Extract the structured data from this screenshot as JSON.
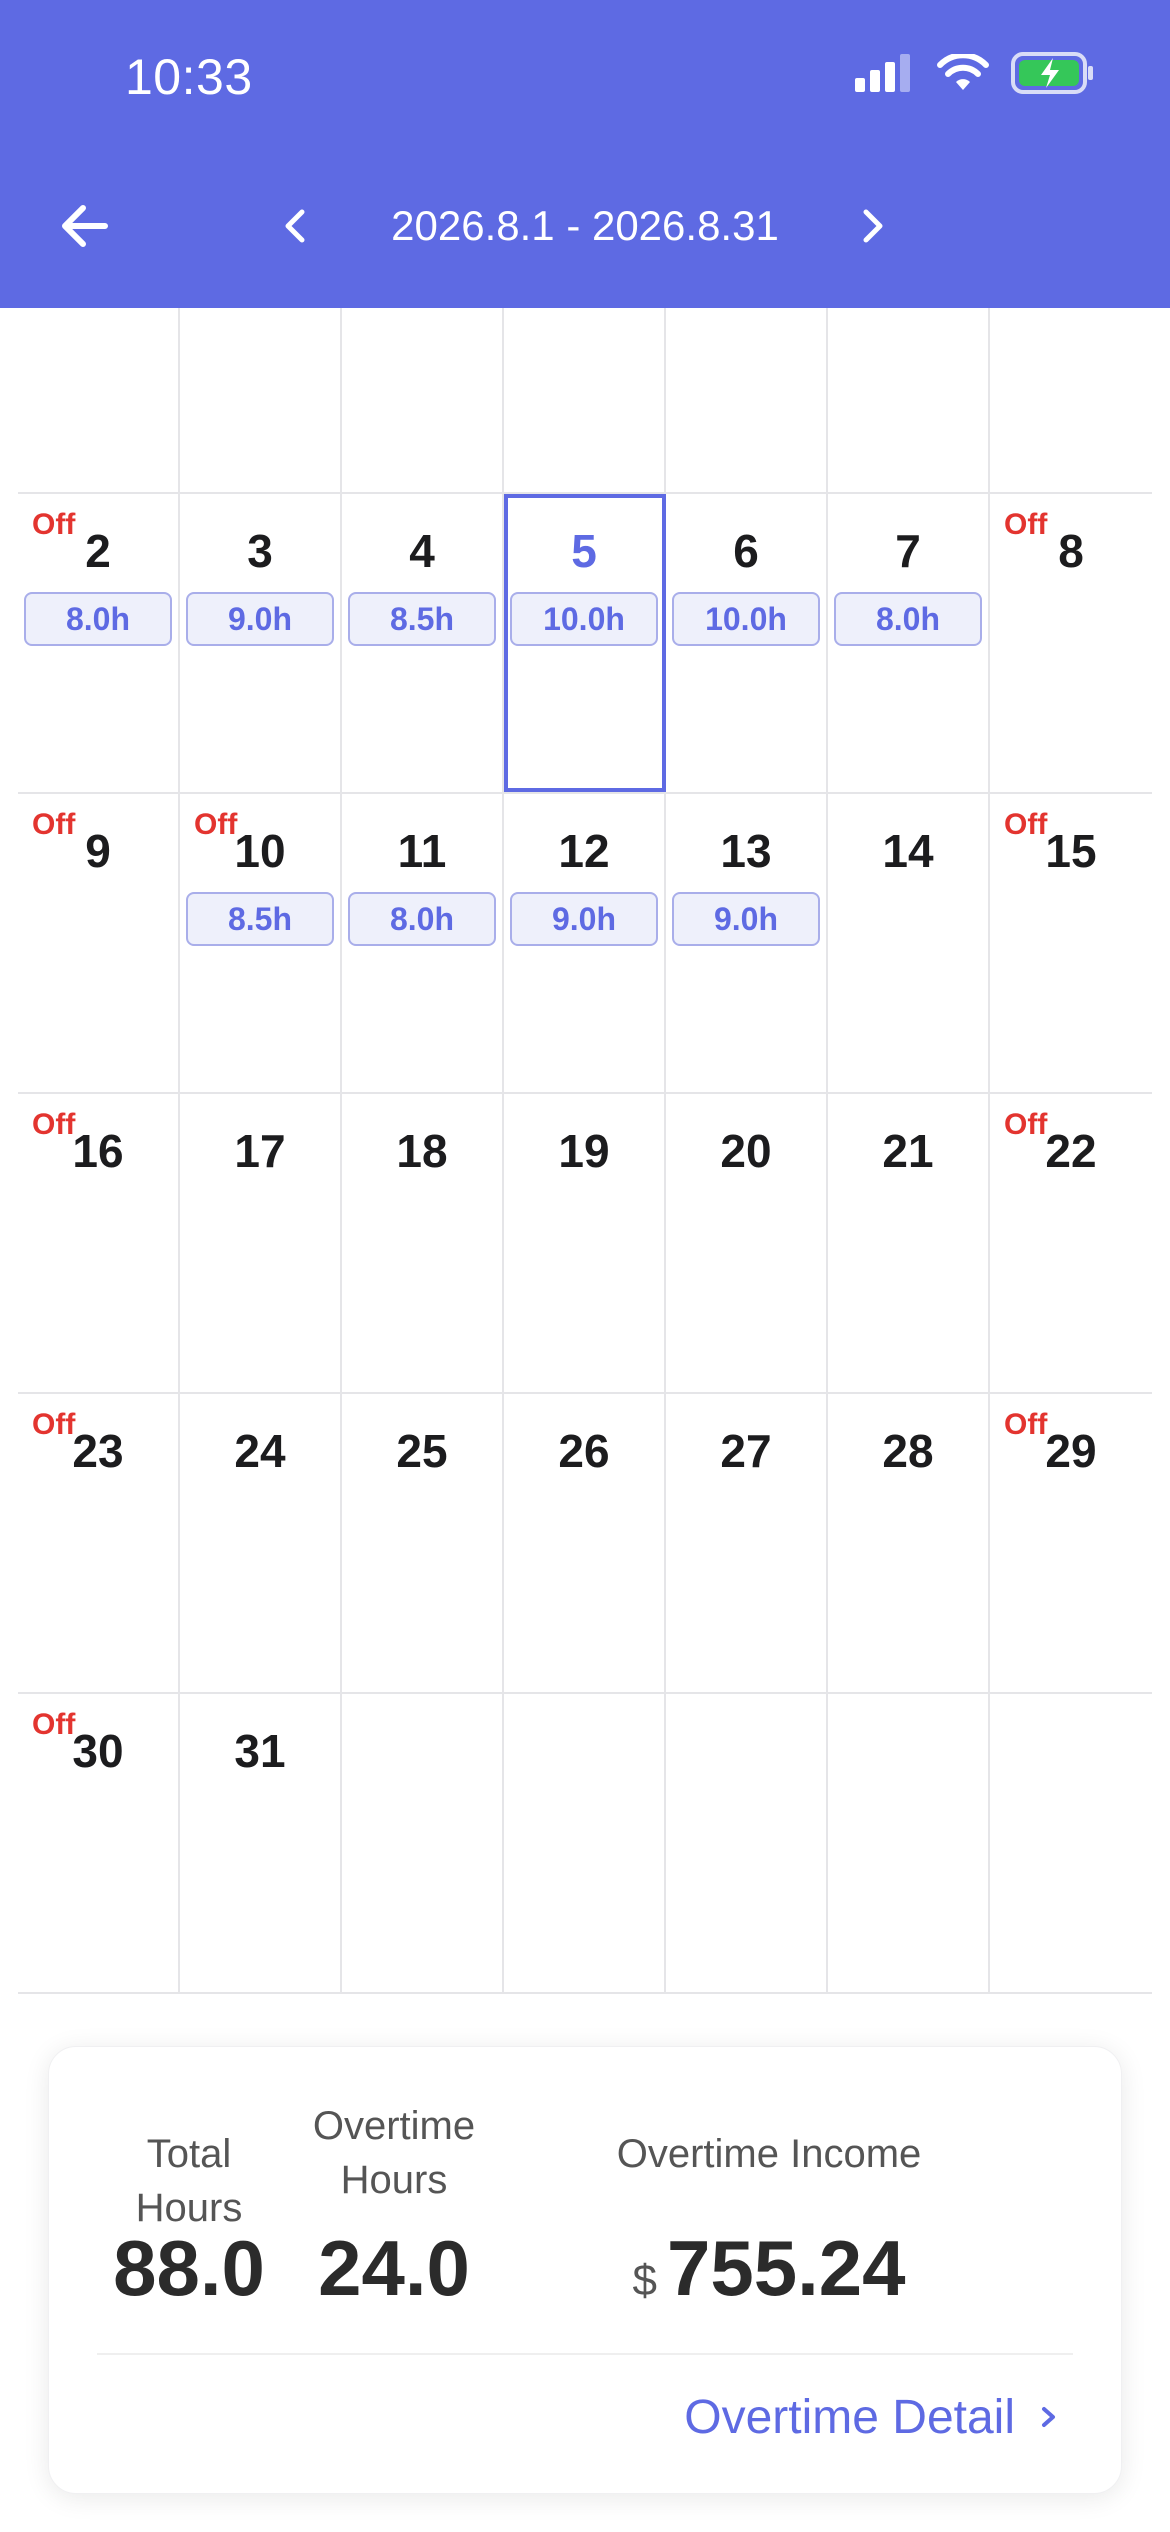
{
  "status_bar": {
    "time": "10:33"
  },
  "header": {
    "date_range": "2026.8.1 - 2026.8.31"
  },
  "calendar": {
    "off_label": "Off",
    "rows": [
      [
        {
          "d": ""
        },
        {
          "d": ""
        },
        {
          "d": ""
        },
        {
          "d": ""
        },
        {
          "d": ""
        },
        {
          "d": ""
        },
        {
          "d": ""
        }
      ],
      [
        {
          "d": "2",
          "off": true,
          "h": "8.0h"
        },
        {
          "d": "3",
          "h": "9.0h"
        },
        {
          "d": "4",
          "h": "8.5h"
        },
        {
          "d": "5",
          "h": "10.0h",
          "sel": true
        },
        {
          "d": "6",
          "h": "10.0h"
        },
        {
          "d": "7",
          "h": "8.0h"
        },
        {
          "d": "8",
          "off": true
        }
      ],
      [
        {
          "d": "9",
          "off": true
        },
        {
          "d": "10",
          "off": true,
          "h": "8.5h"
        },
        {
          "d": "11",
          "h": "8.0h"
        },
        {
          "d": "12",
          "h": "9.0h"
        },
        {
          "d": "13",
          "h": "9.0h"
        },
        {
          "d": "14"
        },
        {
          "d": "15",
          "off": true
        }
      ],
      [
        {
          "d": "16",
          "off": true
        },
        {
          "d": "17"
        },
        {
          "d": "18"
        },
        {
          "d": "19"
        },
        {
          "d": "20"
        },
        {
          "d": "21"
        },
        {
          "d": "22",
          "off": true
        }
      ],
      [
        {
          "d": "23",
          "off": true
        },
        {
          "d": "24"
        },
        {
          "d": "25"
        },
        {
          "d": "26"
        },
        {
          "d": "27"
        },
        {
          "d": "28"
        },
        {
          "d": "29",
          "off": true
        }
      ],
      [
        {
          "d": "30",
          "off": true
        },
        {
          "d": "31"
        },
        {
          "d": ""
        },
        {
          "d": ""
        },
        {
          "d": ""
        },
        {
          "d": ""
        },
        {
          "d": ""
        }
      ]
    ]
  },
  "summary": {
    "total_hours_label": "Total Hours",
    "total_hours_value": "88.0",
    "overtime_hours_label_line1": "Overtime",
    "overtime_hours_label_line2": "Hours",
    "overtime_hours_value": "24.0",
    "overtime_income_label": "Overtime Income",
    "currency_symbol": "$",
    "overtime_income_value": "755.24",
    "detail_link": "Overtime Detail"
  },
  "colors": {
    "accent": "#5e6ae3",
    "off": "#e3342f"
  },
  "icons": {
    "back": "arrow-left-icon",
    "prev": "chevron-left-icon",
    "next": "chevron-right-icon"
  }
}
